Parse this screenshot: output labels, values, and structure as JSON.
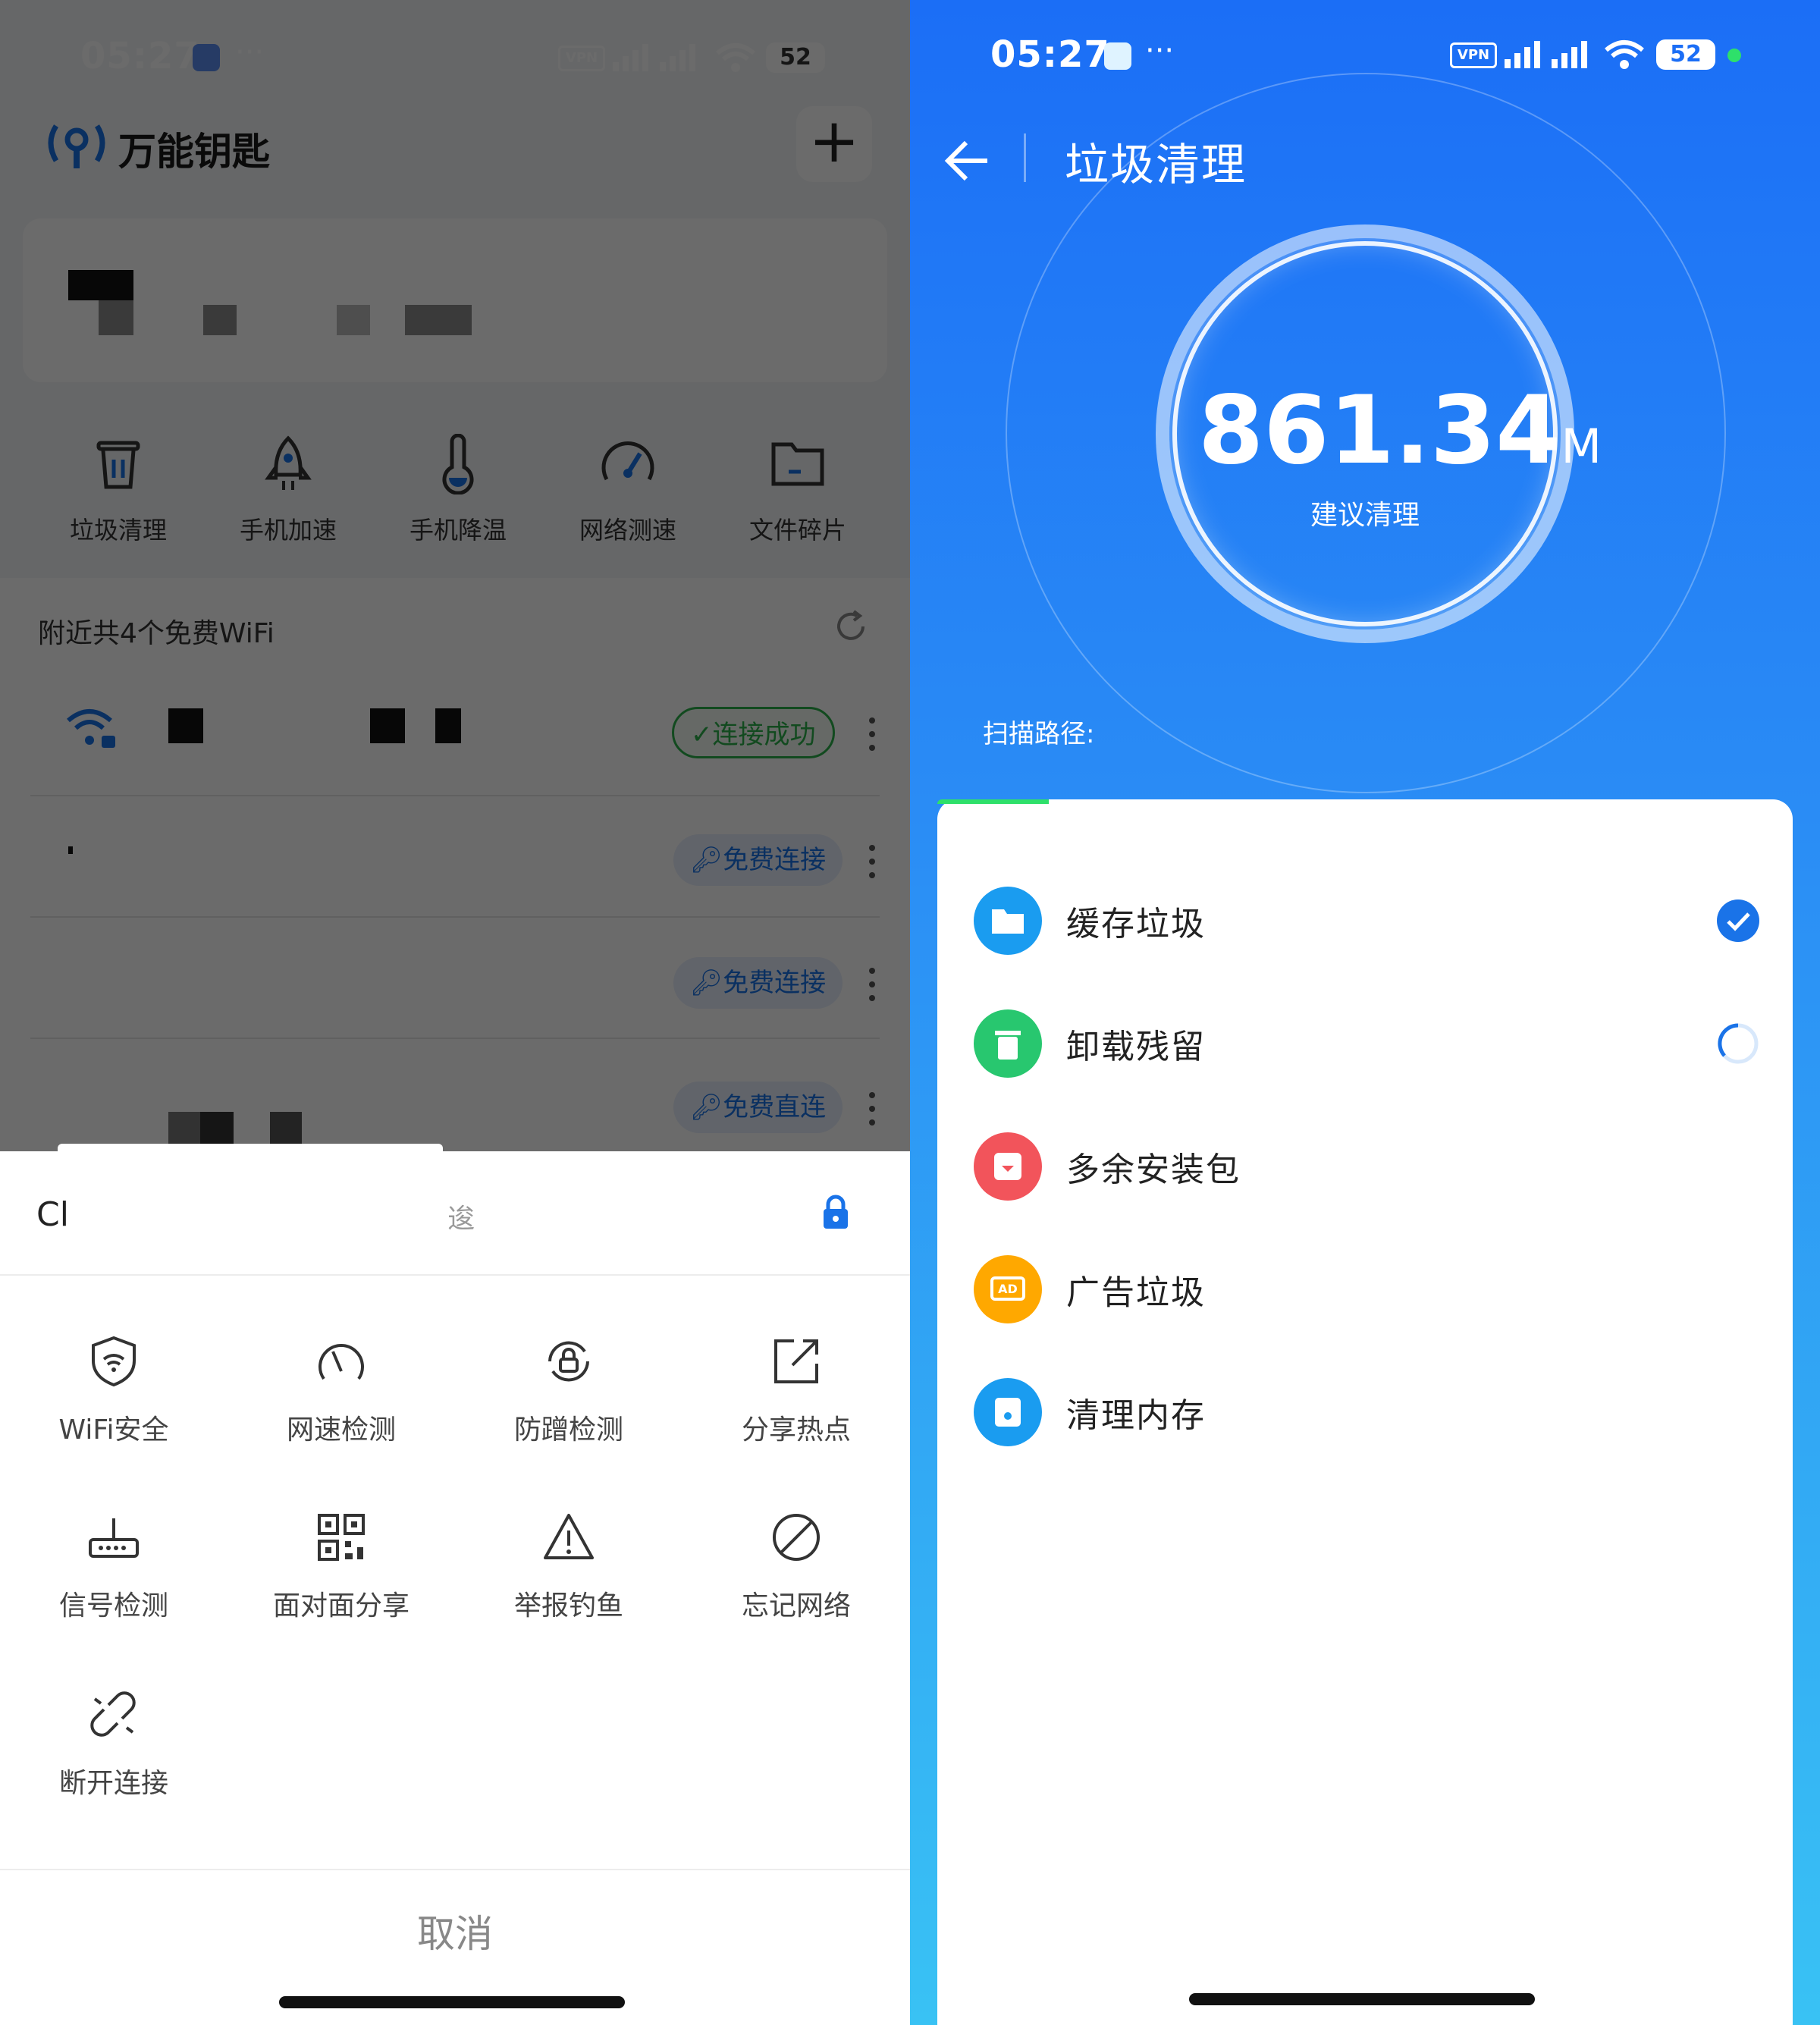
{
  "left": {
    "status_bar": {
      "time": "05:27",
      "more": "···",
      "vpn": "VPN",
      "battery": "52"
    },
    "header": {
      "app_name": "万能钥匙",
      "add_label": "+"
    },
    "tools": [
      {
        "label": "垃圾清理",
        "icon": "trash-icon"
      },
      {
        "label": "手机加速",
        "icon": "rocket-icon"
      },
      {
        "label": "手机降温",
        "icon": "thermometer-icon"
      },
      {
        "label": "网络测速",
        "icon": "speedometer-icon"
      },
      {
        "label": "文件碎片",
        "icon": "folder-icon"
      }
    ],
    "nearby_text": "附近共4个免费WiFi",
    "wifi_list": [
      {
        "status": "✓连接成功"
      },
      {
        "status": "免费连接"
      },
      {
        "status": "免费连接"
      },
      {
        "status": "免费直连"
      }
    ],
    "sheet": {
      "ssid_partial": "Cl",
      "ssid_suffix": "逡",
      "actions": [
        {
          "label": "WiFi安全",
          "icon": "shield-wifi-icon"
        },
        {
          "label": "网速检测",
          "icon": "gauge-icon"
        },
        {
          "label": "防蹭检测",
          "icon": "lock-refresh-icon"
        },
        {
          "label": "分享热点",
          "icon": "share-external-icon"
        },
        {
          "label": "信号检测",
          "icon": "router-icon"
        },
        {
          "label": "面对面分享",
          "icon": "qr-code-icon"
        },
        {
          "label": "举报钓鱼",
          "icon": "warning-icon"
        },
        {
          "label": "忘记网络",
          "icon": "forbidden-icon"
        },
        {
          "label": "断开连接",
          "icon": "broken-link-icon"
        }
      ],
      "cancel_label": "取消"
    }
  },
  "right": {
    "status_bar": {
      "time": "05:27",
      "more": "···",
      "vpn": "VPN",
      "battery": "52"
    },
    "header": {
      "title": "垃圾清理"
    },
    "gauge": {
      "size_value": "861.34",
      "size_unit": "M",
      "recommend": "建议清理"
    },
    "scan_path_label": "扫描路径:",
    "scan_progress": 0.13,
    "items": [
      {
        "label": "缓存垃圾",
        "icon": "folder-icon",
        "color": "#1a9cf0",
        "state": "done"
      },
      {
        "label": "卸载残留",
        "icon": "trash-icon",
        "color": "#28c76f",
        "state": "loading"
      },
      {
        "label": "多余安装包",
        "icon": "package-icon",
        "color": "#f2545b",
        "state": "pending"
      },
      {
        "label": "广告垃圾",
        "icon": "ad-icon",
        "color": "#ffa800",
        "state": "pending"
      },
      {
        "label": "清理内存",
        "icon": "memory-icon",
        "color": "#1a9cf0",
        "state": "pending"
      }
    ]
  }
}
